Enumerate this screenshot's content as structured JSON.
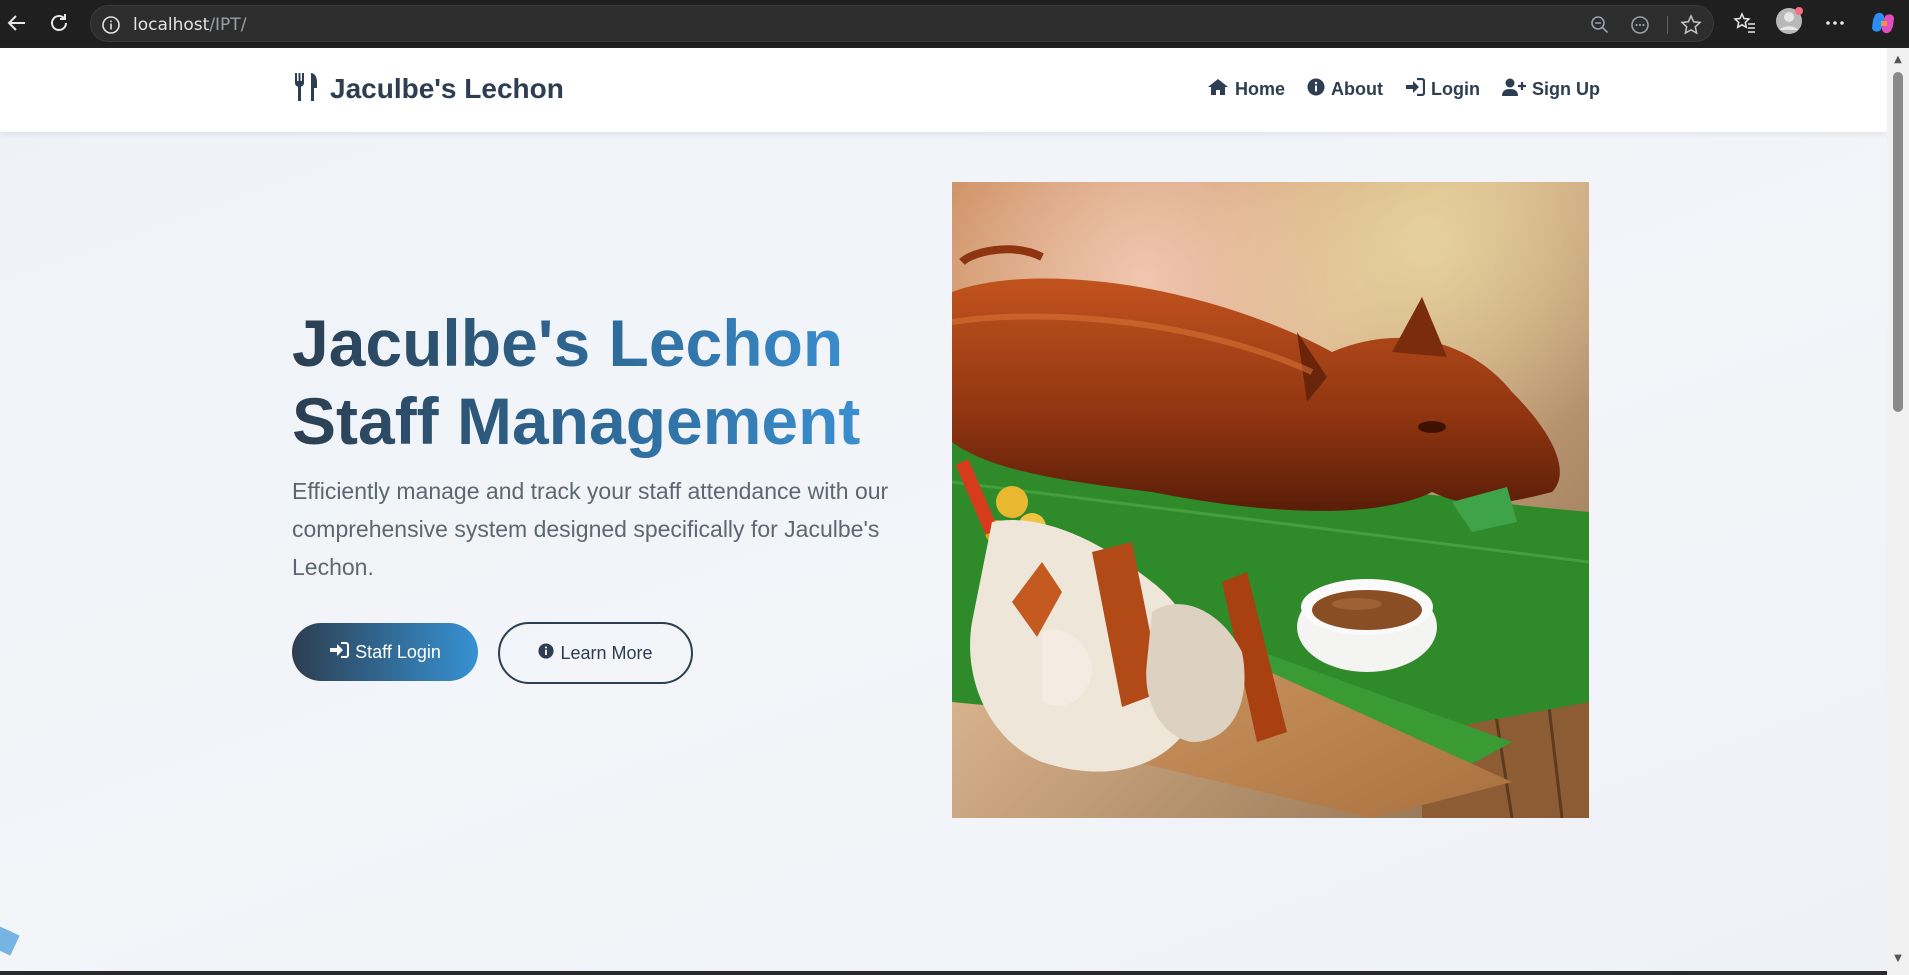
{
  "browser": {
    "url_host": "localhost",
    "url_path": "/IPT/"
  },
  "navbar": {
    "brand": "Jaculbe's Lechon",
    "items": [
      {
        "label": "Home",
        "icon": "home-icon"
      },
      {
        "label": "About",
        "icon": "info-icon"
      },
      {
        "label": "Login",
        "icon": "sign-in-icon"
      },
      {
        "label": "Sign Up",
        "icon": "user-plus-icon"
      }
    ]
  },
  "hero": {
    "title_line1": "Jaculbe's Lechon",
    "title_line2": "Staff Management",
    "description": "Efficiently manage and track your staff attendance with our comprehensive system designed specifically for Jaculbe's Lechon.",
    "primary_button": "Staff Login",
    "secondary_button": "Learn More"
  },
  "colors": {
    "primary": "#2c3e50",
    "accent": "#3792d4"
  }
}
